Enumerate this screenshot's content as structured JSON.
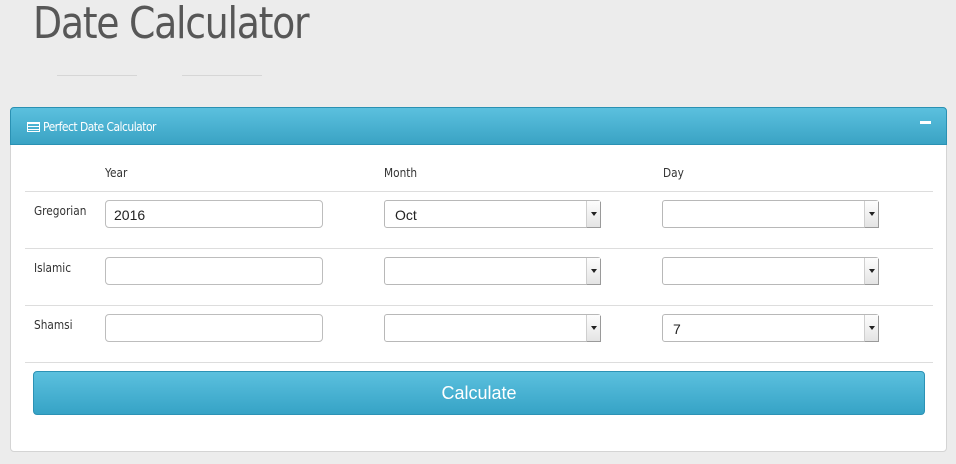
{
  "page": {
    "title": "Date Calculator"
  },
  "panel": {
    "title": "Perfect Date Calculator",
    "icon": "list-icon",
    "collapse_icon": "minus-icon"
  },
  "columns": {
    "year": "Year",
    "month": "Month",
    "day": "Day"
  },
  "rows": {
    "gregorian": {
      "label": "Gregorian",
      "year": "2016",
      "month": "Oct",
      "day": ""
    },
    "islamic": {
      "label": "Islamic",
      "year": "",
      "month": "",
      "day": ""
    },
    "shamsi": {
      "label": "Shamsi",
      "year": "",
      "month": "",
      "day": "7"
    }
  },
  "actions": {
    "calculate_label": "Calculate"
  },
  "colors": {
    "accent": "#5bc0de",
    "accent_dark": "#36a3c6",
    "background": "#ececec"
  }
}
